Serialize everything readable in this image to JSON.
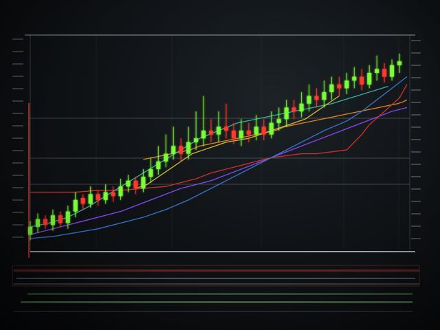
{
  "colors": {
    "background": "#0b0d10",
    "frame": "#cfd6dc",
    "candle_up": "#7dff3a",
    "candle_down": "#ff3b2f",
    "ma_orange": "#f08a2a",
    "ma_red": "#d8342c",
    "ma_purple": "#8a4dff",
    "ma_blue": "#3a7bd5",
    "ma_teal": "#38b7a8",
    "ma_yellow": "#d8c23a"
  },
  "chart_data": {
    "type": "line",
    "title": "",
    "xlabel": "",
    "ylabel": "",
    "grid": true,
    "legend": "none",
    "xlim": [
      0,
      100
    ],
    "ylim": [
      0,
      100
    ],
    "candles": {
      "x": [
        0,
        2,
        4,
        6,
        8,
        10,
        12,
        14,
        16,
        18,
        20,
        22,
        24,
        26,
        28,
        30,
        32,
        34,
        36,
        38,
        40,
        42,
        44,
        46,
        48,
        50,
        52,
        54,
        56,
        58,
        60,
        62,
        64,
        66,
        68,
        70,
        72,
        74,
        76,
        78,
        80,
        82,
        84,
        86,
        88,
        90,
        92,
        94,
        96,
        98
      ],
      "open": [
        6,
        10,
        14,
        11,
        16,
        12,
        18,
        25,
        22,
        27,
        24,
        28,
        26,
        31,
        34,
        30,
        36,
        40,
        44,
        48,
        52,
        48,
        54,
        56,
        60,
        58,
        62,
        60,
        56,
        60,
        58,
        62,
        58,
        64,
        66,
        72,
        70,
        74,
        78,
        76,
        80,
        84,
        82,
        86,
        88,
        84,
        90,
        92,
        88,
        94
      ],
      "close": [
        10,
        14,
        11,
        16,
        12,
        18,
        24,
        22,
        27,
        24,
        28,
        26,
        31,
        34,
        30,
        36,
        40,
        44,
        48,
        52,
        48,
        54,
        56,
        60,
        58,
        62,
        60,
        56,
        60,
        58,
        62,
        58,
        64,
        66,
        72,
        70,
        74,
        78,
        76,
        80,
        84,
        82,
        86,
        88,
        84,
        90,
        92,
        88,
        94,
        96
      ],
      "high": [
        13,
        17,
        16,
        19,
        18,
        21,
        28,
        27,
        31,
        29,
        32,
        31,
        35,
        37,
        36,
        40,
        46,
        52,
        58,
        62,
        56,
        62,
        70,
        78,
        66,
        70,
        74,
        64,
        66,
        64,
        68,
        66,
        70,
        72,
        76,
        76,
        80,
        84,
        82,
        86,
        88,
        88,
        90,
        93,
        92,
        94,
        99,
        95,
        97,
        100
      ],
      "low": [
        3,
        7,
        9,
        8,
        10,
        9,
        15,
        19,
        20,
        21,
        22,
        23,
        24,
        28,
        27,
        28,
        33,
        37,
        41,
        45,
        44,
        45,
        50,
        52,
        54,
        54,
        56,
        53,
        52,
        54,
        55,
        55,
        56,
        60,
        62,
        66,
        67,
        70,
        72,
        72,
        76,
        78,
        79,
        82,
        81,
        82,
        86,
        85,
        86,
        90
      ]
    },
    "series": [
      {
        "values": [
          45,
          46,
          47,
          48,
          49,
          50,
          52,
          53,
          54,
          55,
          56,
          57,
          58,
          59,
          60,
          62,
          63,
          64,
          65,
          66,
          67,
          68,
          69,
          70,
          71,
          72,
          73,
          74,
          75,
          76
        ],
        "x": [
          30,
          32.5,
          35,
          37.5,
          40,
          42.5,
          45,
          47.5,
          50,
          52.5,
          55,
          57.5,
          60,
          62.5,
          65,
          67.5,
          70,
          72.5,
          75,
          77.5,
          80,
          82.5,
          85,
          87.5,
          90,
          92.5,
          95,
          97.5,
          99,
          100
        ],
        "color": "#f08a2a",
        "kind": "ma_orange"
      },
      {
        "values": [
          6,
          8,
          10,
          12,
          14,
          16,
          18,
          21,
          24,
          27,
          30,
          32,
          34,
          37,
          40,
          43,
          46,
          49,
          52,
          55,
          58,
          61,
          64,
          67,
          70,
          72
        ],
        "x": [
          0,
          4,
          8,
          12,
          16,
          20,
          24,
          28,
          32,
          36,
          40,
          44,
          48,
          52,
          56,
          60,
          64,
          68,
          72,
          76,
          80,
          84,
          88,
          92,
          96,
          100
        ],
        "color": "#8a4dff",
        "kind": "ma_purple"
      },
      {
        "values": [
          28,
          28,
          28,
          29,
          29,
          30,
          31,
          33,
          35,
          38,
          40,
          42,
          44,
          46,
          47,
          48,
          48,
          49,
          50,
          54,
          58,
          63,
          70,
          77,
          84
        ],
        "x": [
          0,
          6,
          12,
          18,
          24,
          30,
          36,
          40,
          44,
          48,
          52,
          56,
          60,
          64,
          68,
          72,
          76,
          80,
          84,
          86,
          88,
          90,
          94,
          98,
          100
        ],
        "color": "#d8342c",
        "kind": "ma_red"
      },
      {
        "values": [
          10,
          12,
          15,
          20,
          26,
          32,
          38,
          44,
          50,
          56,
          60,
          64,
          66,
          68,
          70,
          72,
          74,
          77,
          80,
          83
        ],
        "x": [
          0,
          5,
          10,
          15,
          20,
          25,
          30,
          35,
          40,
          45,
          50,
          55,
          60,
          65,
          70,
          75,
          80,
          85,
          90,
          95
        ],
        "color": "#38b7a8",
        "kind": "ma_teal"
      },
      {
        "values": [
          30,
          32,
          36,
          40,
          44,
          48,
          50,
          52,
          54,
          55,
          56,
          58,
          60,
          62,
          64,
          66,
          70,
          74,
          78
        ],
        "x": [
          28,
          31,
          34,
          37,
          40,
          43,
          46,
          49,
          52,
          55,
          58,
          61,
          64,
          67,
          70,
          73,
          76,
          79,
          82
        ],
        "color": "#d8c23a",
        "kind": "ma_yellow"
      },
      {
        "values": [
          4,
          5,
          7,
          9,
          12,
          15,
          19,
          24,
          30,
          36,
          42,
          48,
          54,
          60,
          65,
          70,
          76,
          82,
          88
        ],
        "x": [
          0,
          6,
          12,
          18,
          24,
          30,
          36,
          42,
          48,
          54,
          60,
          66,
          72,
          78,
          84,
          88,
          92,
          96,
          100
        ],
        "color": "#3a7bd5",
        "kind": "ma_blue"
      }
    ]
  }
}
